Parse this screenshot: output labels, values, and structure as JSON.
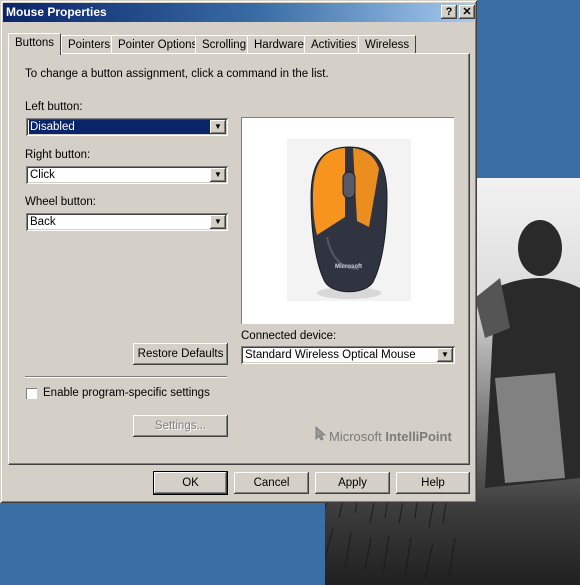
{
  "window": {
    "title": "Mouse Properties",
    "help_button": "?",
    "close_button": "✕"
  },
  "tabs": [
    {
      "label": "Buttons",
      "active": true
    },
    {
      "label": "Pointers"
    },
    {
      "label": "Pointer Options"
    },
    {
      "label": "Scrolling"
    },
    {
      "label": "Hardware"
    },
    {
      "label": "Activities"
    },
    {
      "label": "Wireless"
    }
  ],
  "buttons_tab": {
    "instruction": "To change a button assignment, click a command in the list.",
    "left_button": {
      "label": "Left button:",
      "value": "Disabled"
    },
    "right_button": {
      "label": "Right button:",
      "value": "Click"
    },
    "wheel_button": {
      "label": "Wheel button:",
      "value": "Back"
    },
    "restore_defaults": "Restore Defaults",
    "connected_device": {
      "label": "Connected device:",
      "value": "Standard Wireless Optical Mouse"
    },
    "program_specific": {
      "label": "Enable program-specific settings",
      "checked": false
    },
    "settings_button": "Settings...",
    "brand": {
      "prefix": "Microsoft ",
      "name": "IntelliPoint"
    },
    "mouse_logo_text": "Microsoft",
    "highlight_color": "#f7941d"
  },
  "footer": {
    "ok": "OK",
    "cancel": "Cancel",
    "apply": "Apply",
    "help": "Help"
  }
}
